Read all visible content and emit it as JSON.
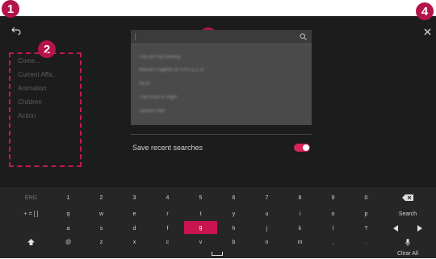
{
  "callouts": [
    "1",
    "2",
    "3",
    "4"
  ],
  "header": {
    "back_icon": "back-arrow-icon",
    "close_icon": "close-icon"
  },
  "categories": [
    "Come...",
    "Current Affa...",
    "Animation",
    "Children",
    "Action"
  ],
  "search": {
    "value": "",
    "search_icon": "search-icon"
  },
  "suggestions": [
    "You are my Destiny",
    "Marvel's Agents of S.H.I.E.L.D.",
    "NCIS",
    "The Price is Right",
    "Tannen Hall"
  ],
  "save_recent": {
    "label": "Save recent searches",
    "enabled": true
  },
  "keyboard": {
    "rows": [
      [
        "ENG",
        "1",
        "2",
        "3",
        "4",
        "5",
        "6",
        "7",
        "8",
        "9",
        "0"
      ],
      [
        "+ = [ ]",
        "q",
        "w",
        "e",
        "r",
        "t",
        "y",
        "u",
        "i",
        "o",
        "p"
      ],
      [
        "",
        "a",
        "s",
        "d",
        "f",
        "g",
        "h",
        "j",
        "k",
        "l",
        "?"
      ],
      [
        "⬆",
        "@",
        "z",
        "x",
        "c",
        "v",
        "b",
        "n",
        "m",
        ",",
        "."
      ]
    ],
    "selected_key": "g",
    "side_keys": [
      "⌫",
      "Search",
      "◀ ▶",
      "🎤",
      "Clear All"
    ],
    "space_symbol": "⎵"
  },
  "colors": {
    "accent": "#c8154f",
    "background": "#1c1c1c",
    "keyboard": "#262626"
  }
}
